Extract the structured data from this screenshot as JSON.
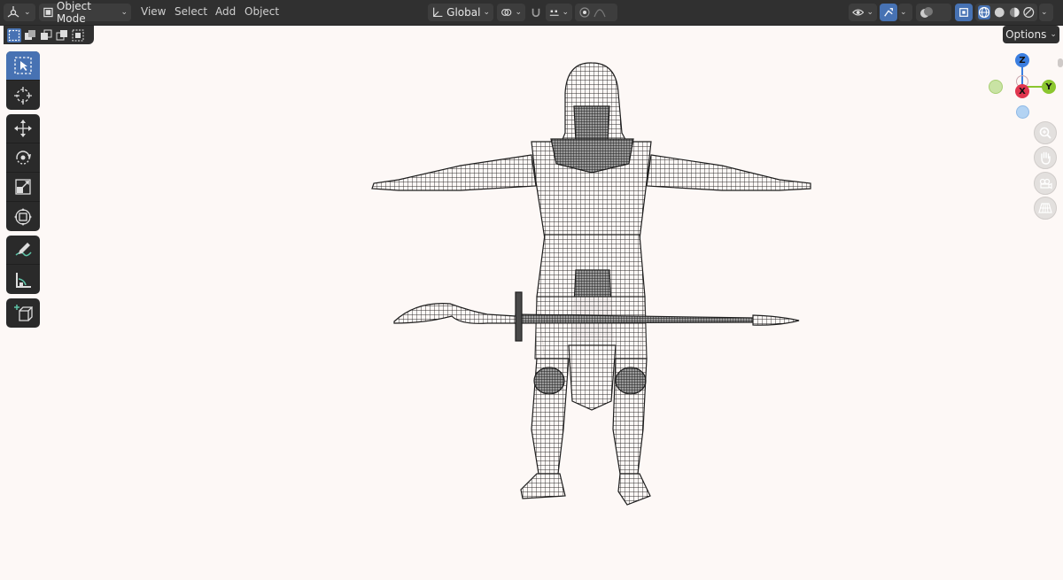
{
  "header": {
    "mode_label": "Object Mode",
    "menus": [
      "View",
      "Select",
      "Add",
      "Object"
    ],
    "transform_orientation": "Global"
  },
  "subheader": {
    "options_label": "Options"
  },
  "toolbar": {
    "tools": [
      "select-box",
      "cursor",
      "move",
      "rotate",
      "scale",
      "transform",
      "annotate",
      "measure",
      "add-cube"
    ]
  },
  "gizmo": {
    "axis_z": "Z",
    "axis_y": "Y",
    "axis_x": "X",
    "colors": {
      "x": "#e0364f",
      "y": "#8bc62f",
      "z": "#3b7ee0",
      "neg_y": "#c9e3a4",
      "neg_z": "#b3d3f3"
    }
  },
  "viewport": {
    "shading": "wireframe",
    "background": "#fdf8f6",
    "object": "pharaoh-warrior-mesh"
  }
}
